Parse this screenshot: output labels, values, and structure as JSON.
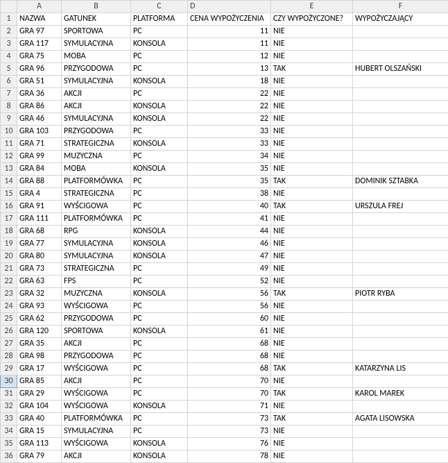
{
  "columns": [
    "A",
    "B",
    "C",
    "D",
    "E",
    "F"
  ],
  "headers": {
    "A": "NAZWA",
    "B": "GATUNEK",
    "C": "PLATFORMA",
    "D": "CENA WYPOŻYCZENIA",
    "E": "CZY WYPOŻYCZONE?",
    "F": "WYPOŻYCZAJĄCY"
  },
  "selectedRow": 30,
  "rows": [
    {
      "n": 1,
      "A": "NAZWA",
      "B": "GATUNEK",
      "C": "PLATFORMA",
      "D": "CENA WYPOŻYCZENIA",
      "E": "CZY WYPOŻYCZONE?",
      "F": "WYPOŻYCZAJĄCY"
    },
    {
      "n": 2,
      "A": "GRA 97",
      "B": "SPORTOWA",
      "C": "PC",
      "D": "11",
      "E": "NIE",
      "F": ""
    },
    {
      "n": 3,
      "A": "GRA 117",
      "B": "SYMULACYJNA",
      "C": "KONSOLA",
      "D": "11",
      "E": "NIE",
      "F": ""
    },
    {
      "n": 4,
      "A": "GRA 75",
      "B": "MOBA",
      "C": "PC",
      "D": "12",
      "E": "NIE",
      "F": ""
    },
    {
      "n": 5,
      "A": "GRA 96",
      "B": "PRZYGODOWA",
      "C": "PC",
      "D": "13",
      "E": "TAK",
      "F": "HUBERT OLSZAŃSKI"
    },
    {
      "n": 6,
      "A": "GRA 51",
      "B": "SYMULACYJNA",
      "C": "KONSOLA",
      "D": "18",
      "E": "NIE",
      "F": ""
    },
    {
      "n": 7,
      "A": "GRA 36",
      "B": "AKCJI",
      "C": "PC",
      "D": "22",
      "E": "NIE",
      "F": ""
    },
    {
      "n": 8,
      "A": "GRA 86",
      "B": "AKCJI",
      "C": "KONSOLA",
      "D": "22",
      "E": "NIE",
      "F": ""
    },
    {
      "n": 9,
      "A": "GRA 46",
      "B": "SYMULACYJNA",
      "C": "KONSOLA",
      "D": "22",
      "E": "NIE",
      "F": ""
    },
    {
      "n": 10,
      "A": "GRA 103",
      "B": "PRZYGODOWA",
      "C": "PC",
      "D": "33",
      "E": "NIE",
      "F": ""
    },
    {
      "n": 11,
      "A": "GRA 71",
      "B": "STRATEGICZNA",
      "C": "KONSOLA",
      "D": "33",
      "E": "NIE",
      "F": ""
    },
    {
      "n": 12,
      "A": "GRA 99",
      "B": "MUZYCZNA",
      "C": "PC",
      "D": "34",
      "E": "NIE",
      "F": ""
    },
    {
      "n": 13,
      "A": "GRA 84",
      "B": "MOBA",
      "C": "KONSOLA",
      "D": "35",
      "E": "NIE",
      "F": ""
    },
    {
      "n": 14,
      "A": "GRA 88",
      "B": "PLATFORMÓWKA",
      "C": "PC",
      "D": "35",
      "E": "TAK",
      "F": "DOMINIK SZTABKA"
    },
    {
      "n": 15,
      "A": "GRA 4",
      "B": "STRATEGICZNA",
      "C": "PC",
      "D": "38",
      "E": "NIE",
      "F": ""
    },
    {
      "n": 16,
      "A": "GRA 91",
      "B": "WYŚCIGOWA",
      "C": "PC",
      "D": "40",
      "E": "TAK",
      "F": "URSZULA FREJ"
    },
    {
      "n": 17,
      "A": "GRA 111",
      "B": "PLATFORMÓWKA",
      "C": "PC",
      "D": "41",
      "E": "NIE",
      "F": ""
    },
    {
      "n": 18,
      "A": "GRA 68",
      "B": "RPG",
      "C": "KONSOLA",
      "D": "44",
      "E": "NIE",
      "F": ""
    },
    {
      "n": 19,
      "A": "GRA 77",
      "B": "SYMULACYJNA",
      "C": "KONSOLA",
      "D": "46",
      "E": "NIE",
      "F": ""
    },
    {
      "n": 20,
      "A": "GRA 80",
      "B": "SYMULACYJNA",
      "C": "KONSOLA",
      "D": "47",
      "E": "NIE",
      "F": ""
    },
    {
      "n": 21,
      "A": "GRA 73",
      "B": "STRATEGICZNA",
      "C": "PC",
      "D": "49",
      "E": "NIE",
      "F": ""
    },
    {
      "n": 22,
      "A": "GRA 63",
      "B": "FPS",
      "C": "PC",
      "D": "52",
      "E": "NIE",
      "F": ""
    },
    {
      "n": 23,
      "A": "GRA 32",
      "B": "MUZYCZNA",
      "C": "KONSOLA",
      "D": "56",
      "E": "TAK",
      "F": "PIOTR RYBA"
    },
    {
      "n": 24,
      "A": "GRA 93",
      "B": "WYŚCIGOWA",
      "C": "PC",
      "D": "56",
      "E": "NIE",
      "F": ""
    },
    {
      "n": 25,
      "A": "GRA 62",
      "B": "PRZYGODOWA",
      "C": "PC",
      "D": "60",
      "E": "NIE",
      "F": ""
    },
    {
      "n": 26,
      "A": "GRA 120",
      "B": "SPORTOWA",
      "C": "KONSOLA",
      "D": "61",
      "E": "NIE",
      "F": ""
    },
    {
      "n": 27,
      "A": "GRA 35",
      "B": "AKCJI",
      "C": "PC",
      "D": "68",
      "E": "NIE",
      "F": ""
    },
    {
      "n": 28,
      "A": "GRA 98",
      "B": "PRZYGODOWA",
      "C": "PC",
      "D": "68",
      "E": "NIE",
      "F": ""
    },
    {
      "n": 29,
      "A": "GRA 17",
      "B": "WYŚCIGOWA",
      "C": "PC",
      "D": "68",
      "E": "TAK",
      "F": "KATARZYNA LIS"
    },
    {
      "n": 30,
      "A": "GRA 85",
      "B": "AKCJI",
      "C": "PC",
      "D": "70",
      "E": "NIE",
      "F": ""
    },
    {
      "n": 31,
      "A": "GRA 29",
      "B": "WYŚCIGOWA",
      "C": "PC",
      "D": "70",
      "E": "TAK",
      "F": "KAROL MAREK"
    },
    {
      "n": 32,
      "A": "GRA 104",
      "B": "WYŚCIGOWA",
      "C": "KONSOLA",
      "D": "71",
      "E": "NIE",
      "F": ""
    },
    {
      "n": 33,
      "A": "GRA 40",
      "B": "PLATFORMÓWKA",
      "C": "PC",
      "D": "73",
      "E": "TAK",
      "F": "AGATA LISOWSKA"
    },
    {
      "n": 34,
      "A": "GRA 15",
      "B": "SYMULACYJNA",
      "C": "PC",
      "D": "73",
      "E": "NIE",
      "F": ""
    },
    {
      "n": 35,
      "A": "GRA 113",
      "B": "WYŚCIGOWA",
      "C": "KONSOLA",
      "D": "76",
      "E": "NIE",
      "F": ""
    },
    {
      "n": 36,
      "A": "GRA 79",
      "B": "AKCJI",
      "C": "KONSOLA",
      "D": "78",
      "E": "NIE",
      "F": ""
    }
  ]
}
